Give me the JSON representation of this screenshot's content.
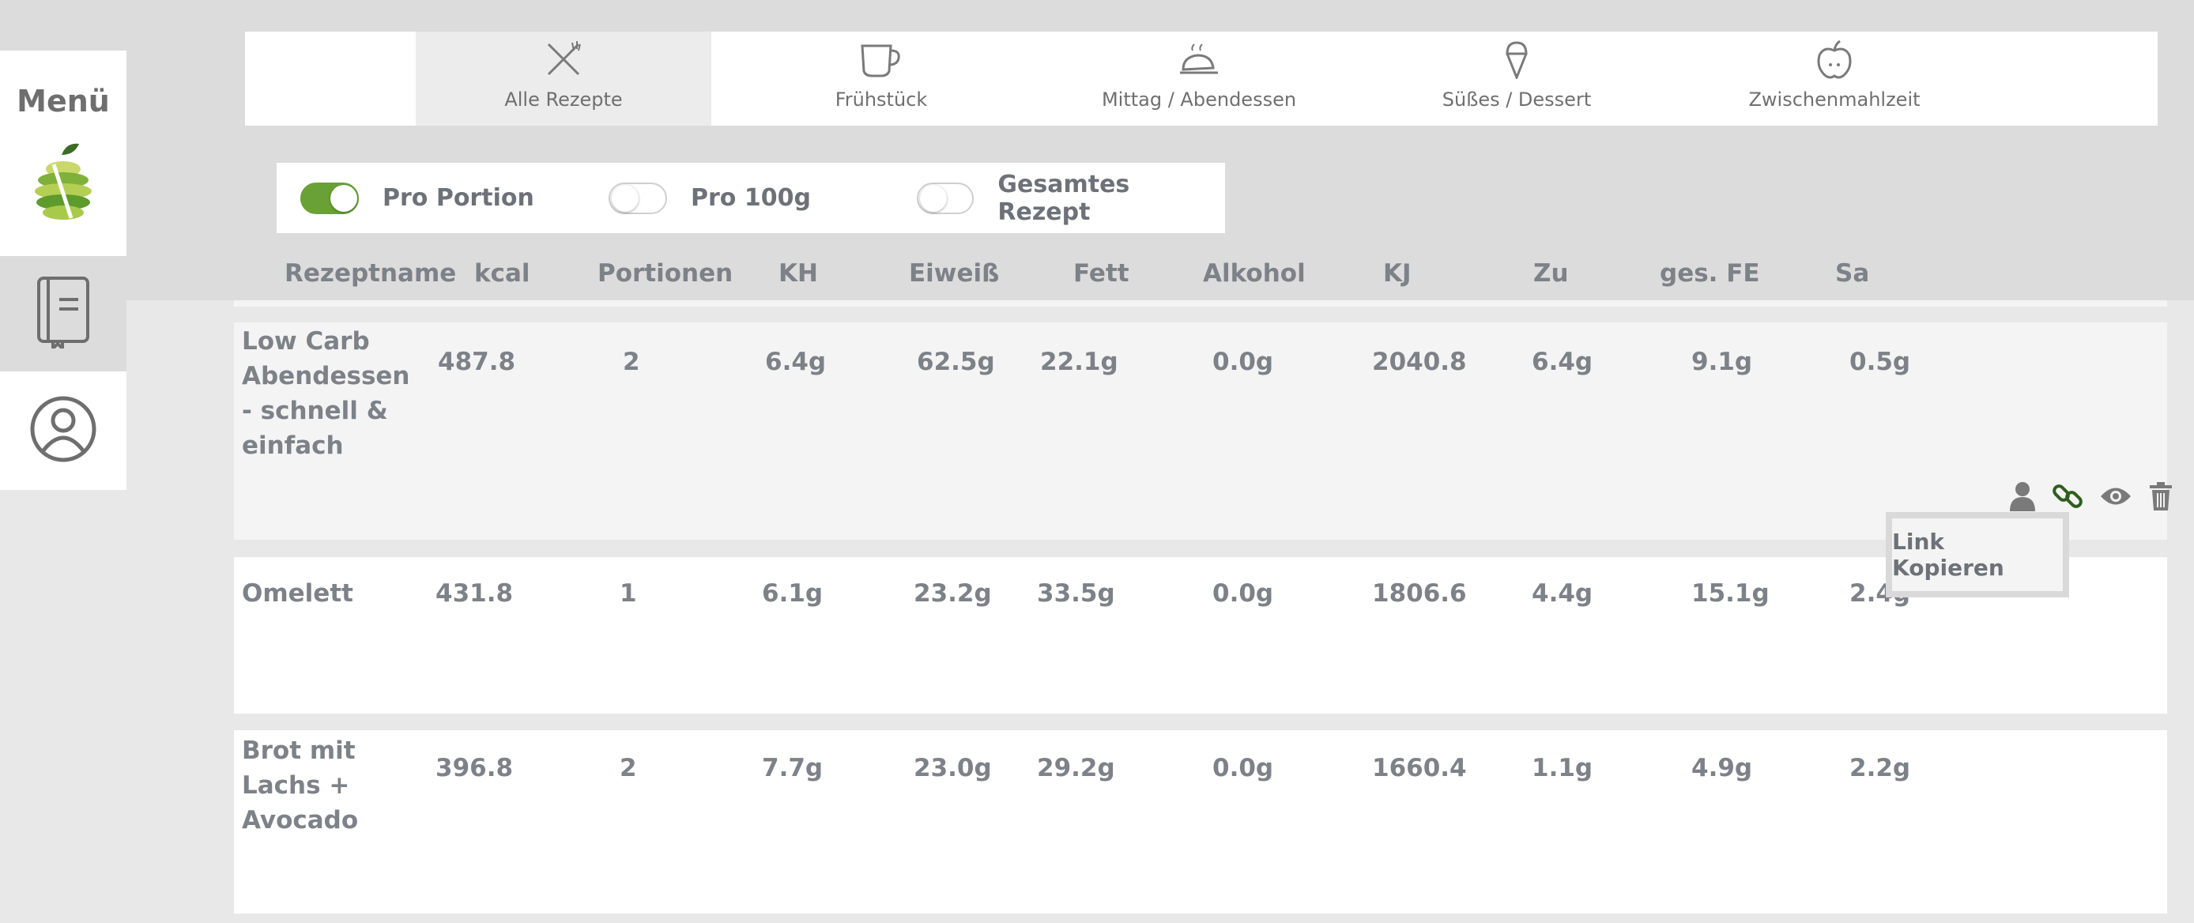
{
  "sidebar": {
    "menu_label": "Menü",
    "items": [
      {
        "icon": "apple-logo-icon"
      },
      {
        "icon": "recipe-book-icon"
      },
      {
        "icon": "user-profile-icon"
      }
    ]
  },
  "categories": [
    {
      "label": "Alle Rezepte",
      "icon": "utensils-icon",
      "active": true
    },
    {
      "label": "Frühstück",
      "icon": "coffee-cup-icon",
      "active": false
    },
    {
      "label": "Mittag / Abendessen",
      "icon": "roast-chicken-icon",
      "active": false
    },
    {
      "label": "Süßes / Dessert",
      "icon": "ice-cream-icon",
      "active": false
    },
    {
      "label": "Zwischenmahlzeit",
      "icon": "apple-icon",
      "active": false
    }
  ],
  "toggles": [
    {
      "label": "Pro Portion",
      "on": true
    },
    {
      "label": "Pro 100g",
      "on": false
    },
    {
      "label": "Gesamtes Rezept",
      "on": false
    }
  ],
  "columns": [
    "Rezeptname",
    "kcal",
    "Portionen",
    "KH",
    "Eiweiß",
    "Fett",
    "Alkohol",
    "KJ",
    "Zu",
    "ges. FE",
    "Sa"
  ],
  "recipes": [
    {
      "name": "Low Carb Abendessen - schnell & einfach",
      "kcal": "487.8",
      "portionen": "2",
      "kh": "6.4g",
      "eiweiss": "62.5g",
      "fett": "22.1g",
      "alkohol": "0.0g",
      "kj": "2040.8",
      "zu": "6.4g",
      "ges_fe": "9.1g",
      "sa": "0.5g"
    },
    {
      "name": "Omelett",
      "kcal": "431.8",
      "portionen": "1",
      "kh": "6.1g",
      "eiweiss": "23.2g",
      "fett": "33.5g",
      "alkohol": "0.0g",
      "kj": "1806.6",
      "zu": "4.4g",
      "ges_fe": "15.1g",
      "sa": "2.4g"
    },
    {
      "name": "Brot mit Lachs + Avocado",
      "kcal": "396.8",
      "portionen": "2",
      "kh": "7.7g",
      "eiweiss": "23.0g",
      "fett": "29.2g",
      "alkohol": "0.0g",
      "kj": "1660.4",
      "zu": "1.1g",
      "ges_fe": "4.9g",
      "sa": "2.2g"
    }
  ],
  "row_actions": [
    {
      "icon": "user-icon"
    },
    {
      "icon": "link-icon"
    },
    {
      "icon": "eye-icon"
    },
    {
      "icon": "trash-icon"
    }
  ],
  "tooltip": {
    "text": "Link Kopieren"
  },
  "colors": {
    "accent_green": "#6aa136",
    "text_gray": "#7d8188",
    "active_tab": "#ececec"
  }
}
